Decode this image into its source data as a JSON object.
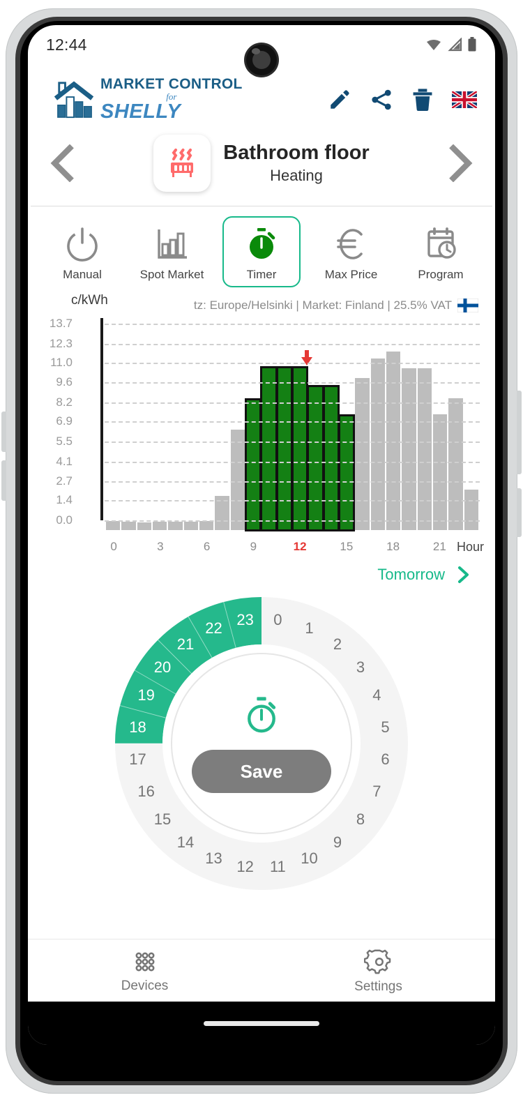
{
  "status_bar": {
    "time": "12:44",
    "wifi_icon": "wifi-icon",
    "signal_icon": "signal-icon",
    "battery_icon": "battery-icon"
  },
  "app_bar": {
    "logo_line1": "MARKET CONTROL",
    "logo_for": "for",
    "logo_line2": "SHELLY",
    "actions": [
      {
        "name": "edit-icon",
        "label": "Edit"
      },
      {
        "name": "share-icon",
        "label": "Share"
      },
      {
        "name": "delete-icon",
        "label": "Delete"
      },
      {
        "name": "language-flag-icon",
        "label": "English (UK)"
      }
    ]
  },
  "device_header": {
    "prev_label": "Previous device",
    "next_label": "Next device",
    "icon": "floor-heating-icon",
    "title": "Bathroom floor",
    "subtitle": "Heating"
  },
  "modes": [
    {
      "id": "manual",
      "label": "Manual",
      "icon": "power-icon",
      "active": false
    },
    {
      "id": "spot",
      "label": "Spot Market",
      "icon": "bar-chart-icon",
      "active": false
    },
    {
      "id": "timer",
      "label": "Timer",
      "icon": "stopwatch-icon",
      "active": true
    },
    {
      "id": "max-price",
      "label": "Max Price",
      "icon": "euro-icon",
      "active": false
    },
    {
      "id": "program",
      "label": "Program",
      "icon": "calendar-clock-icon",
      "active": false
    }
  ],
  "chart_meta": {
    "unit": "c/kWh",
    "info": "tz: Europe/Helsinki | Market: Finland | 25.5% VAT",
    "flag_icon": "finland-flag-icon",
    "tomorrow_label": "Tomorrow",
    "tomorrow_chevron": "chevron-right-icon"
  },
  "chart_data": {
    "type": "bar",
    "title": "",
    "subtitle": "tz: Europe/Helsinki | Market: Finland | 25.5% VAT",
    "xlabel": "Hour",
    "ylabel": "c/kWh",
    "ylim": [
      0.0,
      13.7
    ],
    "grid": true,
    "legend": "none",
    "ytick_labels": [
      "13.7",
      "12.3",
      "11.0",
      "9.6",
      "8.2",
      "6.9",
      "5.5",
      "4.1",
      "2.7",
      "1.4",
      "0.0"
    ],
    "ytick_values": [
      13.7,
      12.3,
      11.0,
      9.6,
      8.2,
      6.9,
      5.5,
      4.1,
      2.7,
      1.4,
      0.0
    ],
    "xtick_labels": [
      "0",
      "3",
      "6",
      "9",
      "12",
      "15",
      "18",
      "21"
    ],
    "xtick_values": [
      0,
      3,
      6,
      9,
      12,
      15,
      18,
      21
    ],
    "current_hour_tick": "12",
    "categories": [
      "0",
      "1",
      "2",
      "3",
      "4",
      "5",
      "6",
      "7",
      "8",
      "9",
      "10",
      "11",
      "12",
      "13",
      "14",
      "15",
      "16",
      "17",
      "18",
      "19",
      "20",
      "21",
      "22",
      "23"
    ],
    "values": [
      0.62,
      0.6,
      0.55,
      0.56,
      0.58,
      0.6,
      0.62,
      2.4,
      7.0,
      9.1,
      11.3,
      11.3,
      11.3,
      10.0,
      10.0,
      7.95,
      10.6,
      11.95,
      12.45,
      11.25,
      11.25,
      8.05,
      9.2,
      2.8
    ],
    "selected_hours": [
      9,
      10,
      11,
      12,
      13,
      14,
      15
    ],
    "current_hour_marker": 12,
    "colors": {
      "bar": "#bdbdbd",
      "bar_selected": "#148014",
      "marker": "#e53935",
      "highlight_tick": "#e53935"
    }
  },
  "dial": {
    "hours": [
      "0",
      "1",
      "2",
      "3",
      "4",
      "5",
      "6",
      "7",
      "8",
      "9",
      "10",
      "11",
      "12",
      "13",
      "14",
      "15",
      "16",
      "17",
      "18",
      "19",
      "20",
      "21",
      "22",
      "23"
    ],
    "selected": [
      18,
      19,
      20,
      21,
      22,
      23
    ],
    "center_icon": "stopwatch-icon",
    "save_label": "Save",
    "accent_color": "#25b98c"
  },
  "bottom_nav": [
    {
      "id": "devices",
      "label": "Devices",
      "icon": "grid-dots-icon"
    },
    {
      "id": "settings",
      "label": "Settings",
      "icon": "gear-icon"
    }
  ]
}
